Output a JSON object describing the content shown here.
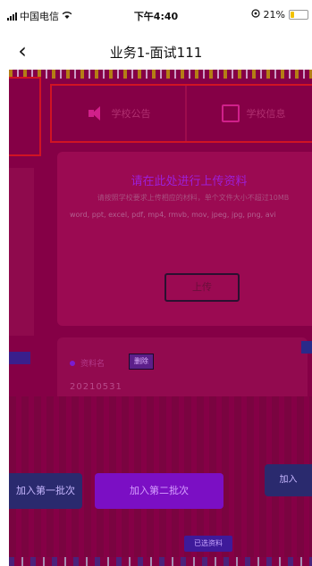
{
  "status_bar": {
    "carrier": "中国电信",
    "time": "下午4:40",
    "battery_pct": "21%",
    "battery_level": 0.21,
    "battery_color": "#f2c200"
  },
  "nav": {
    "back_icon": "chevron-left-icon",
    "back_glyph": "‹",
    "title": "业务1-面试111"
  },
  "tabs": [
    {
      "label": "学校公告",
      "icon": "speaker-icon"
    },
    {
      "label": "学校信息",
      "icon": "book-icon"
    }
  ],
  "upload": {
    "title": "请在此处进行上传资料",
    "hint": "请按照学校要求上传相应的材料，单个文件大小不超过10MB",
    "formats": "word, ppt, excel, pdf, mp4, rmvb, mov, jpeg, jpg, png, avi",
    "button_label": "上传"
  },
  "item": {
    "name": "资料名",
    "tag": "删除",
    "id": "20210531"
  },
  "actions": {
    "first_label": "加入第一批次",
    "second_label": "加入第二批次",
    "third_label": "加入",
    "chip_label": "已选资料"
  },
  "colors": {
    "overlay": "#850046",
    "accent_purple": "#7b0fc4",
    "frame_red": "#d01324",
    "dark_blue": "#2a2a6e"
  }
}
